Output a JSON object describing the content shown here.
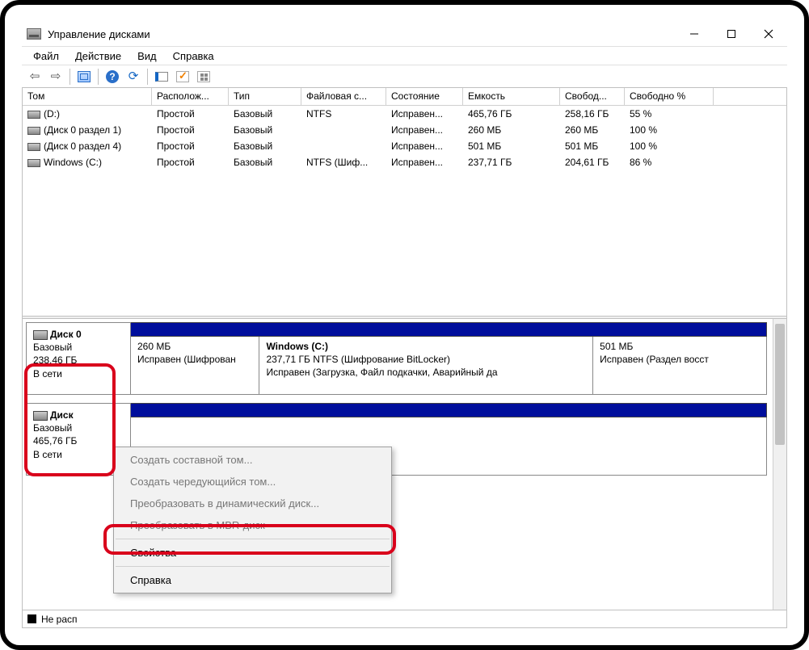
{
  "window": {
    "title": "Управление дисками"
  },
  "menu": {
    "file": "Файл",
    "action": "Действие",
    "view": "Вид",
    "help": "Справка"
  },
  "columns": {
    "volume": "Том",
    "layout": "Располож...",
    "type": "Тип",
    "fs": "Файловая с...",
    "status": "Состояние",
    "capacity": "Емкость",
    "free": "Свобод...",
    "pct": "Свободно %"
  },
  "volumes": [
    {
      "name": "(D:)",
      "layout": "Простой",
      "type": "Базовый",
      "fs": "NTFS",
      "status": "Исправен...",
      "cap": "465,76 ГБ",
      "free": "258,16 ГБ",
      "pct": "55 %"
    },
    {
      "name": "(Диск 0 раздел 1)",
      "layout": "Простой",
      "type": "Базовый",
      "fs": "",
      "status": "Исправен...",
      "cap": "260 МБ",
      "free": "260 МБ",
      "pct": "100 %"
    },
    {
      "name": "(Диск 0 раздел 4)",
      "layout": "Простой",
      "type": "Базовый",
      "fs": "",
      "status": "Исправен...",
      "cap": "501 МБ",
      "free": "501 МБ",
      "pct": "100 %"
    },
    {
      "name": "Windows (C:)",
      "layout": "Простой",
      "type": "Базовый",
      "fs": "NTFS (Шиф...",
      "status": "Исправен...",
      "cap": "237,71 ГБ",
      "free": "204,61 ГБ",
      "pct": "86 %"
    }
  ],
  "disks": [
    {
      "label": "Диск 0",
      "type": "Базовый",
      "size": "238,46 ГБ",
      "status": "В сети",
      "parts": [
        {
          "name": "",
          "line1": "260 МБ",
          "line2": "Исправен (Шифрован",
          "flex": 18
        },
        {
          "name": "Windows  (C:)",
          "line1": "237,71 ГБ NTFS (Шифрование BitLocker)",
          "line2": "Исправен (Загрузка, Файл подкачки, Аварийный да",
          "flex": 50
        },
        {
          "name": "",
          "line1": "501 МБ",
          "line2": "Исправен (Раздел восст",
          "flex": 25
        }
      ]
    },
    {
      "label": "Диск",
      "type": "Базовый",
      "size": "465,76 ГБ",
      "status": "В сети",
      "parts": [
        {
          "name": "",
          "line1": "",
          "line2": "",
          "flex": 1
        }
      ]
    }
  ],
  "context_menu": {
    "items": [
      {
        "label": "Создать составной том...",
        "enabled": false
      },
      {
        "label": "Создать чередующийся том...",
        "enabled": false
      },
      {
        "label": "Преобразовать в динамический диск...",
        "enabled": false
      },
      {
        "label": "Преобразовать в MBR-диск",
        "enabled": false
      },
      {
        "sep": true
      },
      {
        "label": "Свойства",
        "enabled": true
      },
      {
        "sep": true
      },
      {
        "label": "Справка",
        "enabled": true
      }
    ]
  },
  "legend": {
    "unallocated": "Не расп"
  }
}
